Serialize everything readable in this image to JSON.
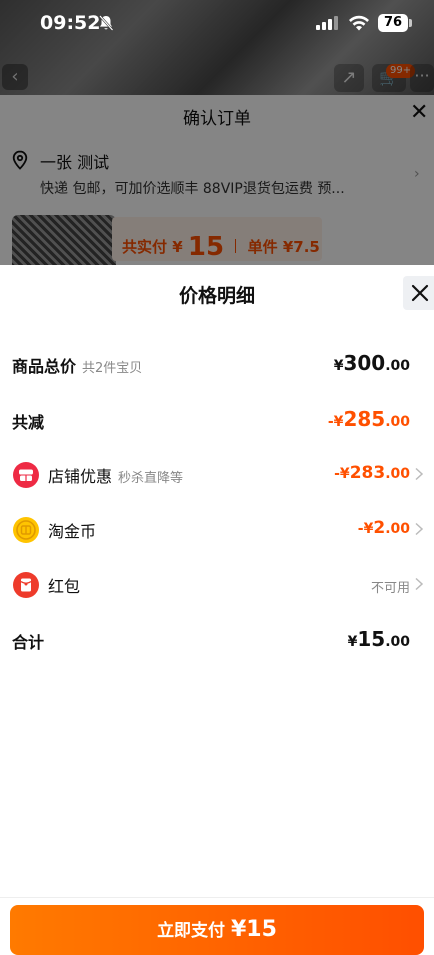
{
  "status_bar": {
    "time": "09:52",
    "battery": "76"
  },
  "background_page": {
    "title": "确认订单",
    "address": {
      "name": "一张 测试",
      "shipping": "快递 包邮，可加价选顺丰 88VIP退货包运费 预..."
    },
    "price_line": {
      "label": "共实付",
      "currency": "¥",
      "amount": "15",
      "unit_label": "单件",
      "unit_price": "¥7.5"
    },
    "cart_badge": "99+"
  },
  "sheet": {
    "title": "价格明细",
    "rows": [
      {
        "label": "商品总价",
        "sub": "共2件宝贝",
        "currency": "¥",
        "int": "300",
        "dec": ".00"
      },
      {
        "label": "共减",
        "currency": "-¥",
        "int": "285",
        "dec": ".00"
      },
      {
        "label": "店铺优惠",
        "sub": "秒杀直降等",
        "currency": "-¥",
        "int": "283",
        "dec": ".00"
      },
      {
        "label": "淘金币",
        "currency": "-¥",
        "int": "2",
        "dec": ".00"
      },
      {
        "label": "红包",
        "status": "不可用"
      },
      {
        "label": "合计",
        "currency": "¥",
        "int": "15",
        "dec": ".00"
      }
    ]
  },
  "pay_button": {
    "label": "立即支付",
    "currency": "¥",
    "amount": "15"
  },
  "colors": {
    "accent": "#ff5000",
    "shop_icon": "#ee2a44",
    "coin_icon": "#ffc400",
    "redpacket_icon": "#ee3b2b"
  },
  "icons": [
    "location-icon",
    "shop-discount-icon",
    "coin-icon",
    "red-packet-icon",
    "close-icon",
    "chevron-right-icon"
  ]
}
